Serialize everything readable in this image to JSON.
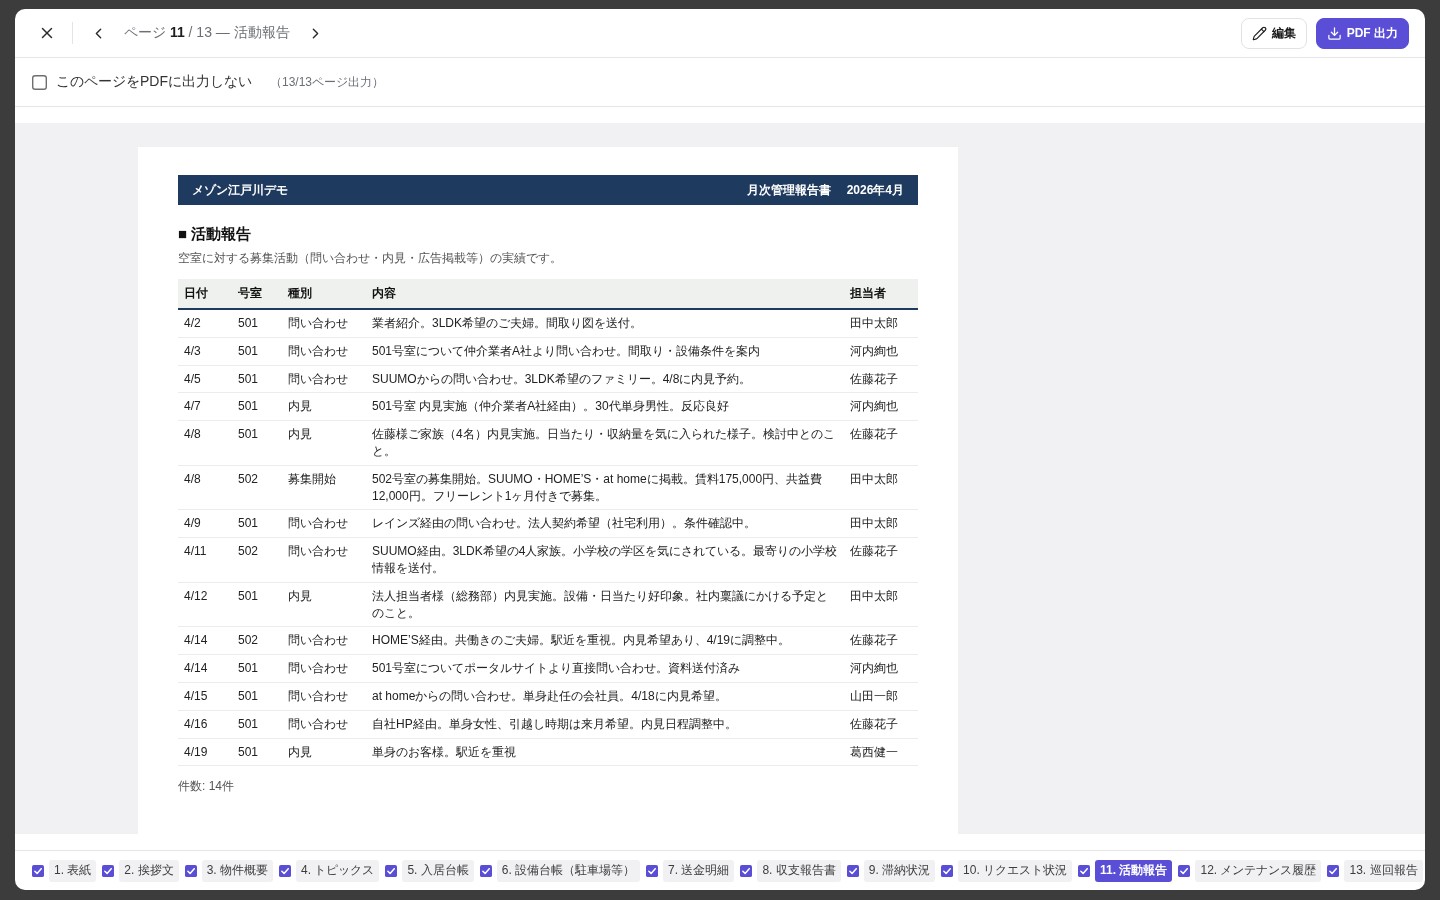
{
  "toolbar": {
    "title": "ページ **11** / 13 — 活動報告",
    "buttons": [
      {
        "kind": "edit",
        "label": "編集"
      },
      {
        "kind": "export",
        "label": "PDF 出力"
      }
    ]
  },
  "exclude_option": {
    "label": "このページをPDFに出力しない",
    "checked": false,
    "note": "（13/13ページ出力）"
  },
  "document": {
    "property_name": "メゾン江戸川デモ",
    "report_type": "月次管理報告書",
    "period": "2026年4月",
    "section_title": "■ 活動報告",
    "description": "空室に対する募集活動（問い合わせ・内見・広告掲載等）の実績です。",
    "table": {
      "columns": [
        "日付",
        "号室",
        "種別",
        "内容",
        "担当者"
      ],
      "rows": [
        {
          "date": "4/2",
          "room": "501",
          "type": "問い合わせ",
          "content": "業者紹介。3LDK希望のご夫婦。間取り図を送付。",
          "staff": "田中太郎"
        },
        {
          "date": "4/3",
          "room": "501",
          "type": "問い合わせ",
          "content": "501号室について仲介業者A社より問い合わせ。間取り・設備条件を案内",
          "staff": "河内絢也"
        },
        {
          "date": "4/5",
          "room": "501",
          "type": "問い合わせ",
          "content": "SUUMOからの問い合わせ。3LDK希望のファミリー。4/8に内見予約。",
          "staff": "佐藤花子"
        },
        {
          "date": "4/7",
          "room": "501",
          "type": "内見",
          "content": "501号室 内見実施（仲介業者A社経由）。30代単身男性。反応良好",
          "staff": "河内絢也"
        },
        {
          "date": "4/8",
          "room": "501",
          "type": "内見",
          "content": "佐藤様ご家族（4名）内見実施。日当たり・収納量を気に入られた様子。検討中とのこと。",
          "staff": "佐藤花子"
        },
        {
          "date": "4/8",
          "room": "502",
          "type": "募集開始",
          "content": "502号室の募集開始。SUUMO・HOME’S・at homeに掲載。賃料175,000円、共益費12,000円。フリーレント1ヶ月付きで募集。",
          "staff": "田中太郎"
        },
        {
          "date": "4/9",
          "room": "501",
          "type": "問い合わせ",
          "content": "レインズ経由の問い合わせ。法人契約希望（社宅利用）。条件確認中。",
          "staff": "田中太郎"
        },
        {
          "date": "4/11",
          "room": "502",
          "type": "問い合わせ",
          "content": "SUUMO経由。3LDK希望の4人家族。小学校の学区を気にされている。最寄りの小学校情報を送付。",
          "staff": "佐藤花子"
        },
        {
          "date": "4/12",
          "room": "501",
          "type": "内見",
          "content": "法人担当者様（総務部）内見実施。設備・日当たり好印象。社内稟議にかける予定とのこと。",
          "staff": "田中太郎"
        },
        {
          "date": "4/14",
          "room": "502",
          "type": "問い合わせ",
          "content": "HOME’S経由。共働きのご夫婦。駅近を重視。内見希望あり、4/19に調整中。",
          "staff": "佐藤花子"
        },
        {
          "date": "4/14",
          "room": "501",
          "type": "問い合わせ",
          "content": "501号室についてポータルサイトより直接問い合わせ。資料送付済み",
          "staff": "河内絢也"
        },
        {
          "date": "4/15",
          "room": "501",
          "type": "問い合わせ",
          "content": "at homeからの問い合わせ。単身赴任の会社員。4/18に内見希望。",
          "staff": "山田一郎"
        },
        {
          "date": "4/16",
          "room": "501",
          "type": "問い合わせ",
          "content": "自社HP経由。単身女性、引越し時期は来月希望。内見日程調整中。",
          "staff": "佐藤花子"
        },
        {
          "date": "4/19",
          "room": "501",
          "type": "内見",
          "content": "単身のお客様。駅近を重視",
          "staff": "葛西健一"
        }
      ]
    },
    "footer": "件数: 14件"
  },
  "page_tabs": [
    {
      "label": "1. 表紙",
      "included": true,
      "selected": false
    },
    {
      "label": "2. 挨拶文",
      "included": true,
      "selected": false
    },
    {
      "label": "3. 物件概要",
      "included": true,
      "selected": false
    },
    {
      "label": "4. トピックス",
      "included": true,
      "selected": false
    },
    {
      "label": "5. 入居台帳",
      "included": true,
      "selected": false
    },
    {
      "label": "6. 設備台帳（駐車場等）",
      "included": true,
      "selected": false
    },
    {
      "label": "7. 送金明細",
      "included": true,
      "selected": false
    },
    {
      "label": "8. 収支報告書",
      "included": true,
      "selected": false
    },
    {
      "label": "9. 滞納状況",
      "included": true,
      "selected": false
    },
    {
      "label": "10. リクエスト状況",
      "included": true,
      "selected": false
    },
    {
      "label": "11. 活動報告",
      "included": true,
      "selected": true
    },
    {
      "label": "12. メンテナンス履歴",
      "included": true,
      "selected": false
    },
    {
      "label": "13. 巡回報告",
      "included": true,
      "selected": false
    }
  ]
}
